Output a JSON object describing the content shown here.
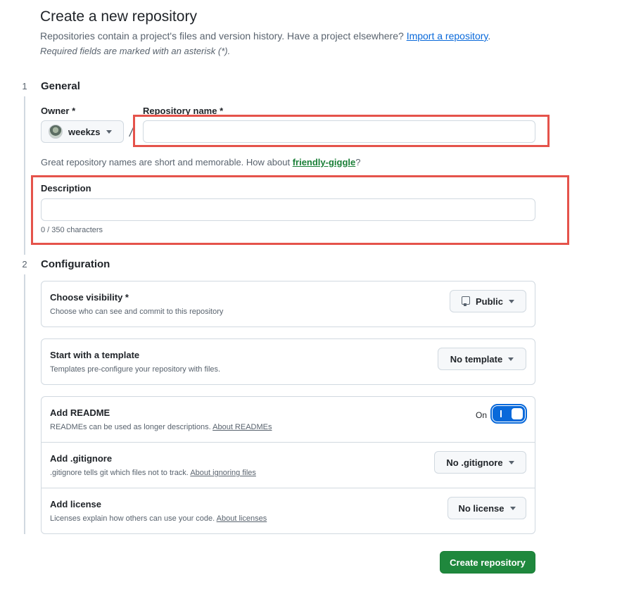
{
  "header": {
    "title": "Create a new repository",
    "subtitle_text": "Repositories contain a project's files and version history. Have a project elsewhere?",
    "import_link": "Import a repository",
    "subtitle_end": ".",
    "required_note": "Required fields are marked with an asterisk (*)."
  },
  "steps": {
    "general": {
      "number": "1",
      "title": "General"
    },
    "configuration": {
      "number": "2",
      "title": "Configuration"
    }
  },
  "general": {
    "owner_label": "Owner *",
    "owner_value": "weekzs",
    "slash": "/",
    "repo_name_label": "Repository name *",
    "repo_name_value": "",
    "name_hint_prefix": "Great repository names are short and memorable. How about",
    "name_suggestion": "friendly-giggle",
    "name_hint_suffix": "?",
    "description_label": "Description",
    "description_value": "",
    "char_count": "0 / 350 characters"
  },
  "configuration": {
    "visibility": {
      "title": "Choose visibility *",
      "desc": "Choose who can see and commit to this repository",
      "value": "Public",
      "icon": "repo-icon"
    },
    "template": {
      "title": "Start with a template",
      "desc": "Templates pre-configure your repository with files.",
      "value": "No template"
    },
    "readme": {
      "title": "Add README",
      "desc": "READMEs can be used as longer descriptions.",
      "link": "About READMEs",
      "toggle_label": "On",
      "toggle_on": true
    },
    "gitignore": {
      "title": "Add .gitignore",
      "desc": ".gitignore tells git which files not to track.",
      "link": "About ignoring files",
      "value": "No .gitignore"
    },
    "license": {
      "title": "Add license",
      "desc": "Licenses explain how others can use your code.",
      "link": "About licenses",
      "value": "No license"
    }
  },
  "footer": {
    "create_label": "Create repository"
  },
  "colors": {
    "primary_button": "#1f883d",
    "link": "#0969da",
    "suggestion": "#1a7f37",
    "toggle": "#0969da",
    "highlight": "#e5534b"
  }
}
